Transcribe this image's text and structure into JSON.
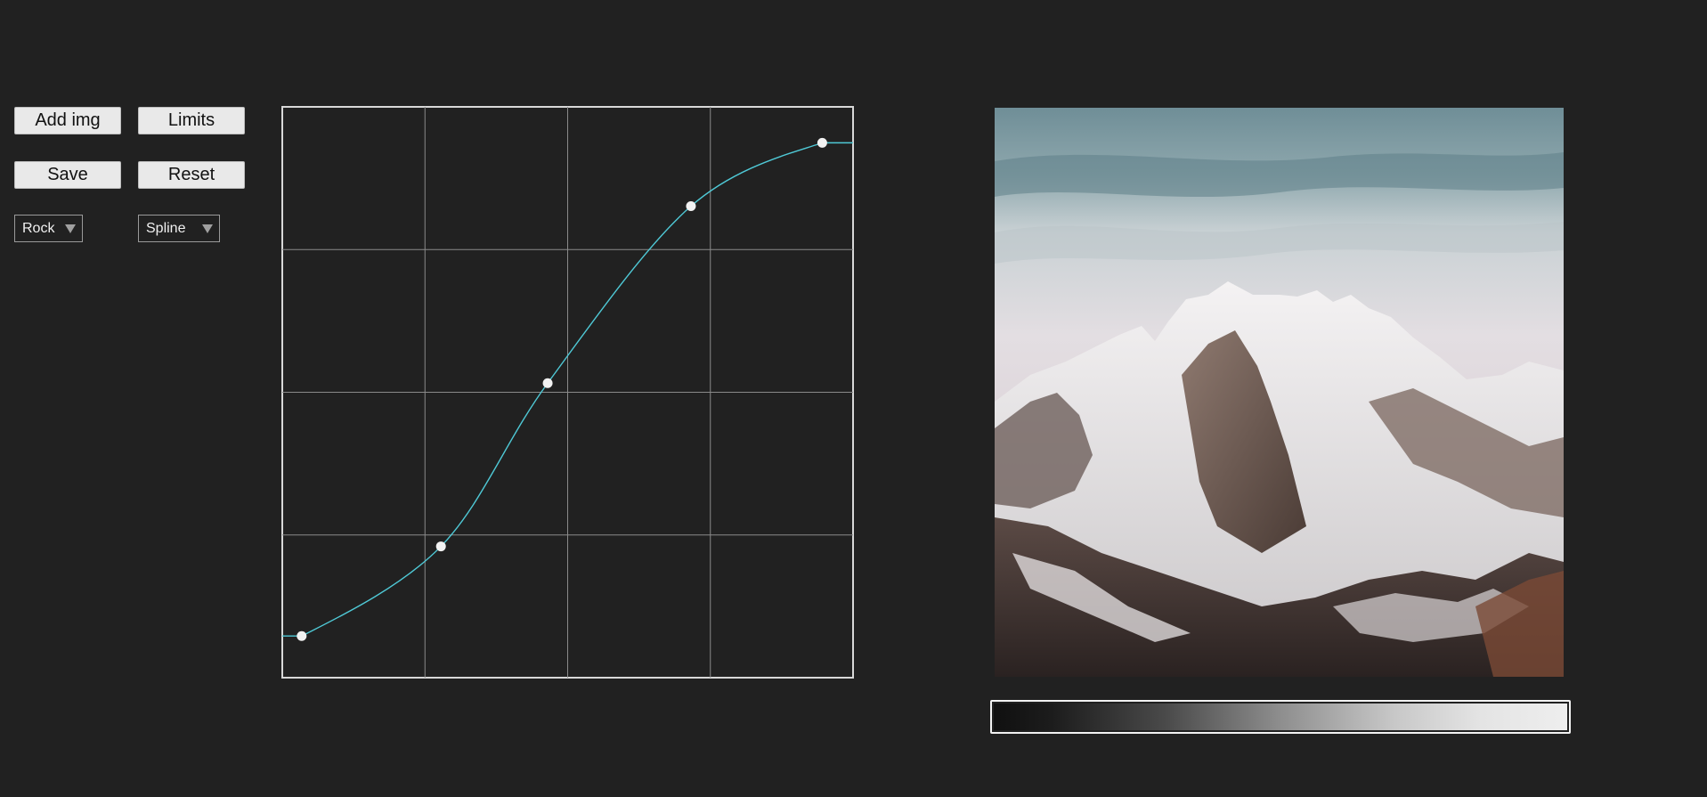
{
  "toolbar": {
    "add_img_label": "Add img",
    "limits_label": "Limits",
    "save_label": "Save",
    "reset_label": "Reset"
  },
  "preset_select": {
    "selected": "Rock"
  },
  "interp_select": {
    "selected": "Spline"
  },
  "curve": {
    "grid_divisions": 4,
    "line_color": "#4fc9d6",
    "handle_color": "#f2f2f2",
    "control_points": [
      {
        "x": 0.034,
        "y": 0.073
      },
      {
        "x": 0.278,
        "y": 0.23
      },
      {
        "x": 0.465,
        "y": 0.516
      },
      {
        "x": 0.716,
        "y": 0.826
      },
      {
        "x": 0.946,
        "y": 0.937
      }
    ]
  },
  "preview": {
    "image_icon": "mountain-photo"
  },
  "gradient": {
    "from": "#101010",
    "to": "#eeeeee"
  }
}
